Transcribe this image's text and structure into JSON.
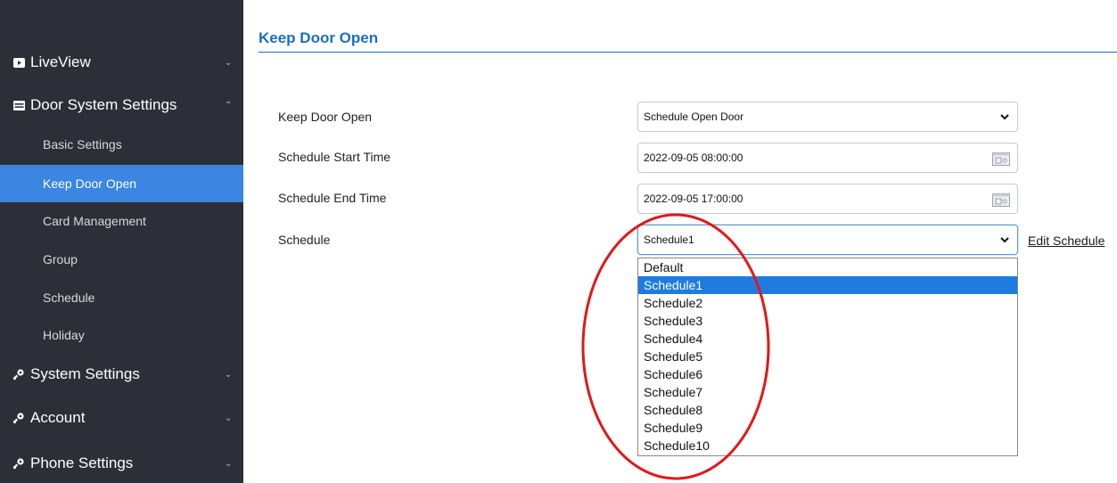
{
  "sidebar": {
    "items": [
      {
        "label": "LiveView",
        "icon": "video-icon"
      },
      {
        "label": "Door System Settings",
        "icon": "panel-icon"
      },
      {
        "label": "Basic Settings"
      },
      {
        "label": "Keep Door Open"
      },
      {
        "label": "Card Management"
      },
      {
        "label": "Group"
      },
      {
        "label": "Schedule"
      },
      {
        "label": "Holiday"
      },
      {
        "label": "System Settings",
        "icon": "gear-key-icon"
      },
      {
        "label": "Account",
        "icon": "gear-key-icon"
      },
      {
        "label": "Phone Settings",
        "icon": "gear-key-icon"
      }
    ],
    "active_item": "Keep Door Open"
  },
  "main": {
    "title": "Keep Door Open",
    "fields": {
      "keep_door_open": {
        "label": "Keep Door Open",
        "value": "Schedule Open Door"
      },
      "start_time": {
        "label": "Schedule Start Time",
        "value": "2022-09-05 08:00:00"
      },
      "end_time": {
        "label": "Schedule End Time",
        "value": "2022-09-05 17:00:00"
      },
      "schedule": {
        "label": "Schedule",
        "value": "Schedule1"
      }
    },
    "edit_schedule_label": "Edit Schedule",
    "schedule_options": [
      "Default",
      "Schedule1",
      "Schedule2",
      "Schedule3",
      "Schedule4",
      "Schedule5",
      "Schedule6",
      "Schedule7",
      "Schedule8",
      "Schedule9",
      "Schedule10"
    ]
  },
  "colors": {
    "sidebar_bg": "#2c2f38",
    "active_item": "#3a86e0",
    "title": "#1e6fb8",
    "selected_option": "#1e7ce0",
    "annotation": "#e01818"
  }
}
